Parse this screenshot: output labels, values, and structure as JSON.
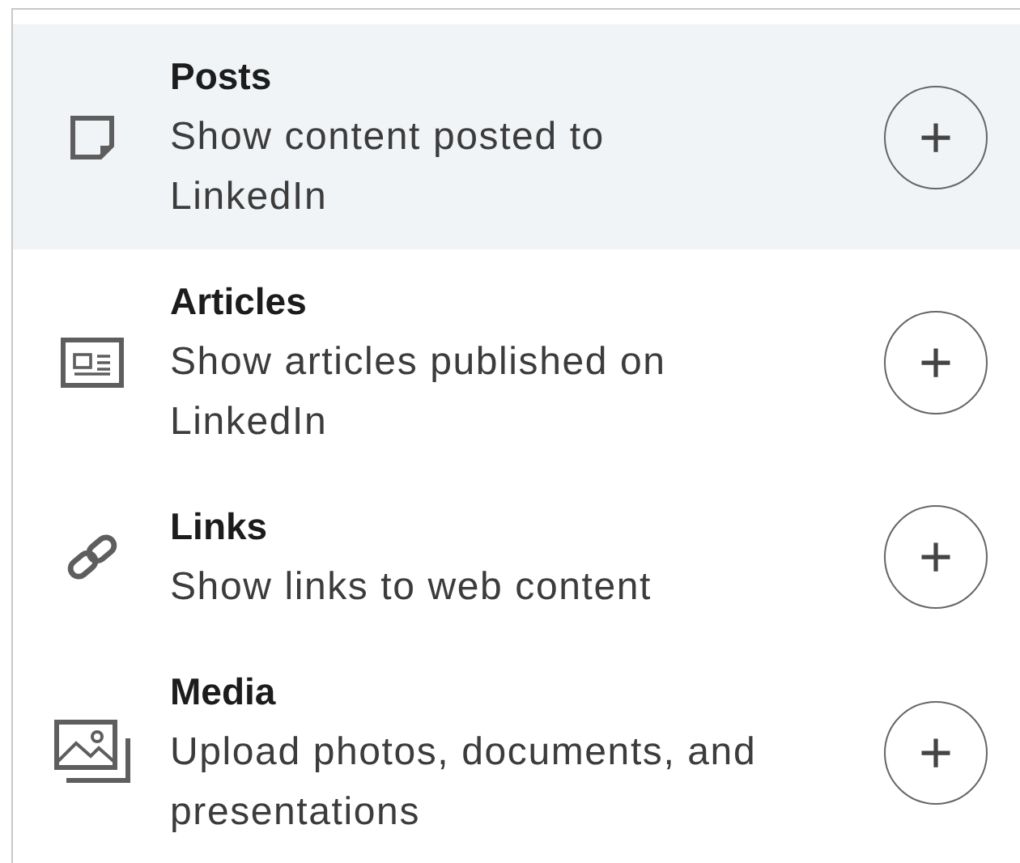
{
  "items": [
    {
      "kind": "post",
      "title": "Posts",
      "description": [
        "Show content posted to",
        "LinkedIn"
      ],
      "selected": true,
      "button": "+"
    },
    {
      "kind": "article",
      "title": "Articles",
      "description": [
        "Show articles published on",
        "LinkedIn"
      ],
      "selected": false,
      "button": "+"
    },
    {
      "kind": "link",
      "title": "Links",
      "description": [
        "Show links to web content"
      ],
      "selected": false,
      "button": "+"
    },
    {
      "kind": "media",
      "title": "Media",
      "description": [
        "Upload photos, documents, and",
        "presentations"
      ],
      "selected": false,
      "button": "+"
    }
  ]
}
